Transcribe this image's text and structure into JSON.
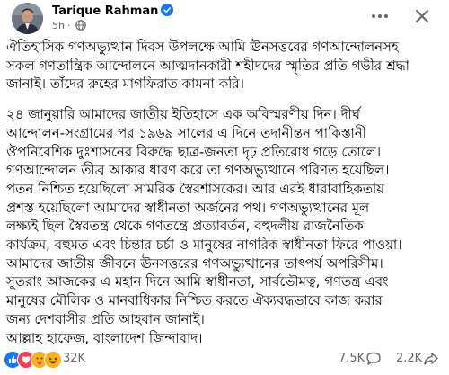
{
  "author": {
    "name": "Tarique Rahman",
    "time": "5h"
  },
  "post": {
    "paragraphs": [
      "ঐতিহাসিক গণঅভ্যুত্থান দিবস উপলক্ষে আমি ঊনসত্তরের গণআন্দোলনসহ\nসকল গণতান্ত্রিক আন্দোলনে আত্মদানকারী শহীদদের স্মৃতির প্রতি গভীর শ্রদ্ধা\nজানাই। তাঁদের রুহের মাগফিরাত কামনা করি।",
      "২৪ জানুয়ারি আমাদের জাতীয় ইতিহাসে এক অবিস্মরণীয় দিন। দীর্ঘ\nআন্দোলন-সংগ্রামের পর ১৯৬৯ সালের এ দিনে তদানীন্তন পাকিস্তানী\nঔপনিবেশিক দুঃশাসনের বিরুদ্ধে ছাত্র-জনতা দৃঢ় প্রতিরোধ গড়ে তোলে।\nগণআন্দোলন তীব্র আকার ধারণ করে তা গণঅভ্যুত্থানে পরিণত হয়েছিল।\nপতন নিশ্চিত হয়েছিলো সামরিক স্বৈরশাসকের। আর এরই ধারাবাহিকতায়\nপ্রশস্ত হয়েছিলো আমাদের স্বাধীনতা অর্জনের পথ। গণঅভ্যুত্থানের মূল\nলক্ষ্যই ছিল স্বৈরতন্ত্র থেকে গণতন্ত্রে প্রত্যাবর্তন, বহুদলীয় রাজনৈতিক\nকার্যক্রম, বহুমত এবং চিন্তার চর্চা ও মানুষের নাগরিক স্বাধীনতা ফিরে পাওয়া।\nআমাদের জাতীয় জীবনে ঊনসত্তরের গণঅভ্যুত্থানের তাৎপর্য অপরিসীম।\nসুতরাং আজকের এ মহান দিনে আমি স্বাধীনতা, সার্বভৌমত্ব, গণতন্ত্র এবং\nমানুষের মৌলিক ও মানবাধিকার নিশ্চিত করতে ঐক্যবদ্ধভাবে কাজ করার\nজন্য দেশবাসীর প্রতি আহবান জানাই।\nআল্লাহ হাফেজ, বাংলাদেশ জিন্দাবাদ।"
    ]
  },
  "stats": {
    "reactions": "32K",
    "comments": "7.5K",
    "shares": "2.2K"
  },
  "colors": {
    "like": "#1877f2",
    "love": "#f33e58",
    "care": "#f7b125",
    "meta_text": "#65676b"
  },
  "icons": {
    "verified": "verified-badge-icon",
    "audience": "globe-icon",
    "more": "more-options-icon",
    "close": "close-icon",
    "comment": "comment-icon",
    "share": "share-icon"
  }
}
